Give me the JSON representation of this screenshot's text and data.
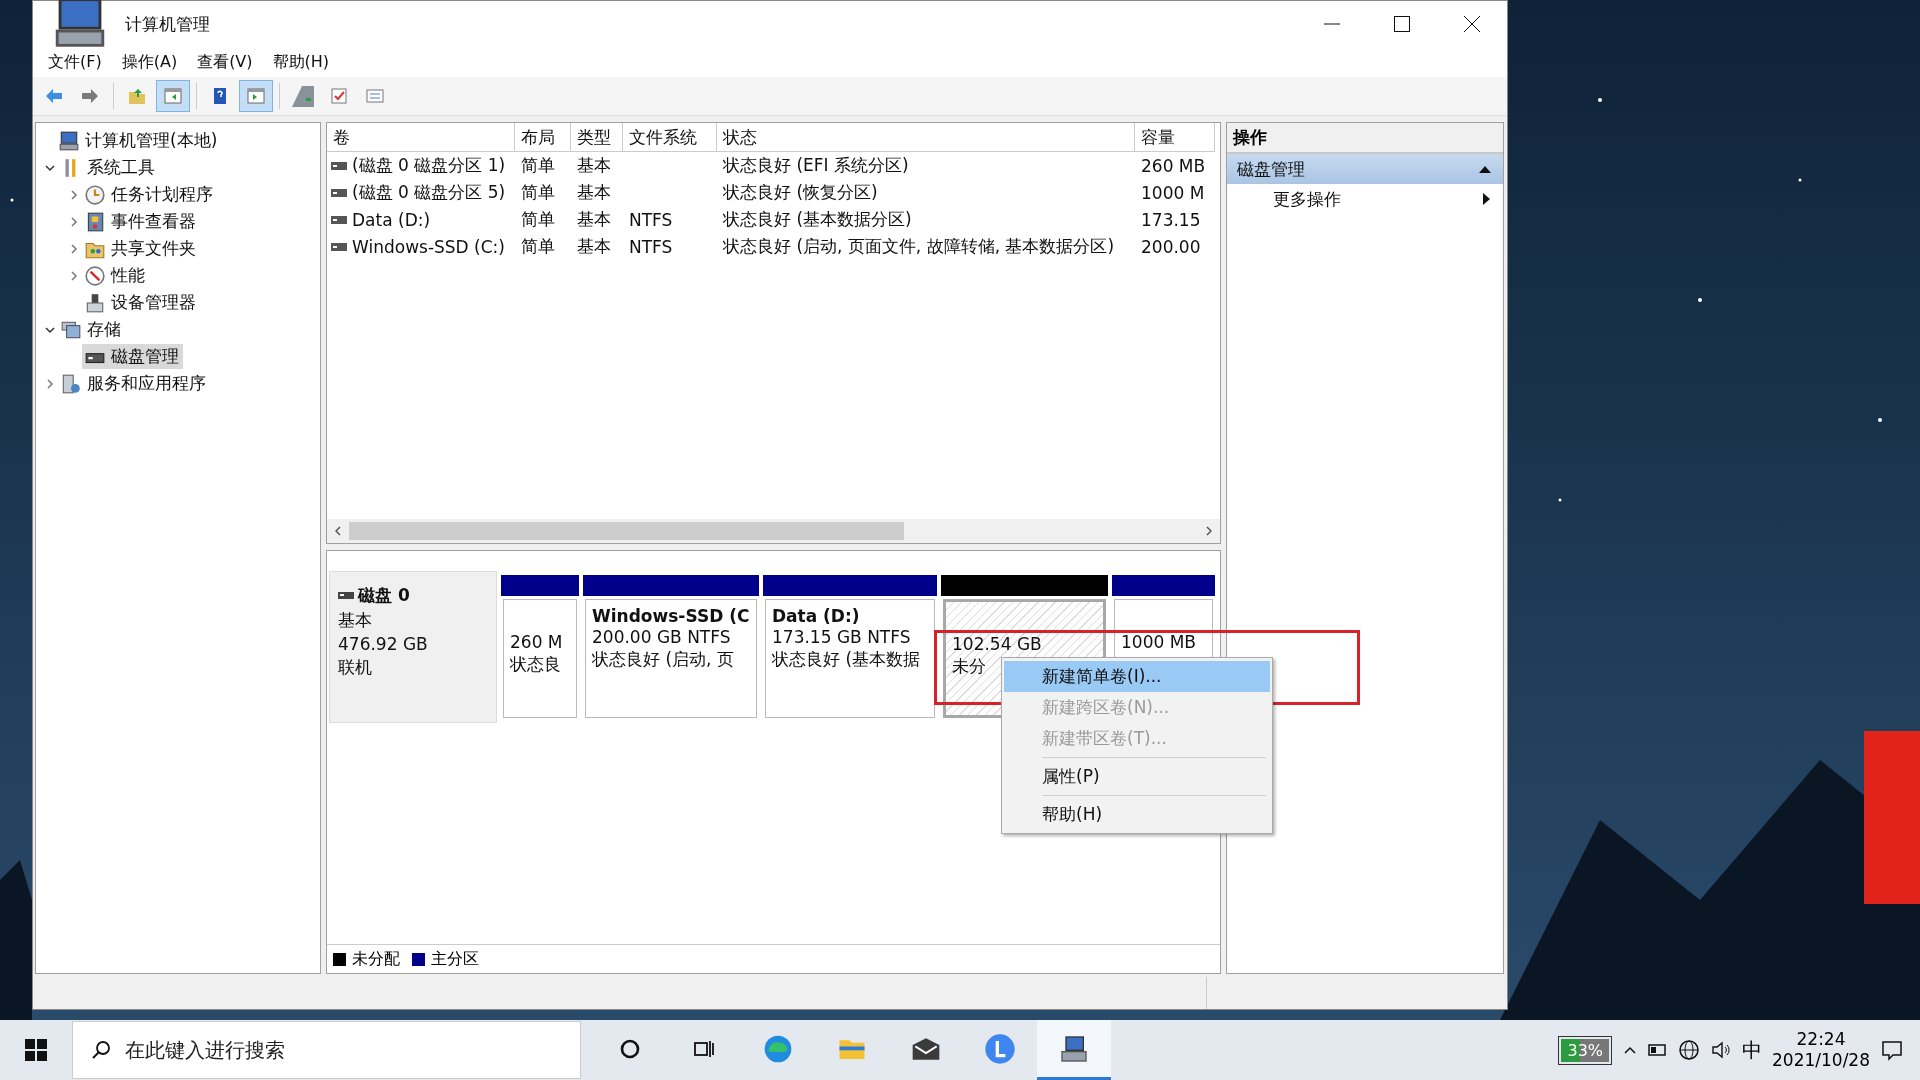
{
  "window": {
    "title": "计算机管理"
  },
  "menu": [
    "文件(F)",
    "操作(A)",
    "查看(V)",
    "帮助(H)"
  ],
  "toolbar": {
    "groups": [
      [
        {
          "kind": "back",
          "pressed": false
        },
        {
          "kind": "forward",
          "pressed": false
        }
      ],
      [
        {
          "kind": "up",
          "pressed": false
        },
        {
          "kind": "tree",
          "pressed": true
        }
      ],
      [
        {
          "kind": "help",
          "pressed": false
        },
        {
          "kind": "pane",
          "pressed": true
        }
      ],
      [
        {
          "kind": "connect",
          "pressed": false
        },
        {
          "kind": "check",
          "pressed": false
        },
        {
          "kind": "list",
          "pressed": false
        }
      ]
    ]
  },
  "tree": [
    {
      "label": "计算机管理(本地)",
      "kind": "computer",
      "selected": false,
      "children": [
        {
          "label": "系统工具",
          "kind": "tools",
          "expanded": true,
          "selected": false,
          "children": [
            {
              "label": "任务计划程序",
              "kind": "clock",
              "expanded": false,
              "selected": false
            },
            {
              "label": "事件查看器",
              "kind": "event",
              "expanded": false,
              "selected": false
            },
            {
              "label": "共享文件夹",
              "kind": "share",
              "expanded": false,
              "selected": false
            },
            {
              "label": "性能",
              "kind": "perf",
              "expanded": false,
              "selected": false
            },
            {
              "label": "设备管理器",
              "kind": "device",
              "selected": false
            }
          ]
        },
        {
          "label": "存储",
          "kind": "storage",
          "expanded": true,
          "selected": false,
          "children": [
            {
              "label": "磁盘管理",
              "kind": "disk",
              "selected": true
            }
          ]
        },
        {
          "label": "服务和应用程序",
          "kind": "services",
          "expanded": false,
          "selected": false
        }
      ]
    }
  ],
  "table": {
    "columns": [
      "卷",
      "布局",
      "类型",
      "文件系统",
      "状态",
      "容量"
    ],
    "rows": [
      {
        "cells": [
          "(磁盘 0 磁盘分区 1)",
          "简单",
          "基本",
          "",
          "状态良好 (EFI 系统分区)",
          "260 MB"
        ]
      },
      {
        "cells": [
          "(磁盘 0 磁盘分区 5)",
          "简单",
          "基本",
          "",
          "状态良好 (恢复分区)",
          "1000 M"
        ]
      },
      {
        "cells": [
          "Data (D:)",
          "简单",
          "基本",
          "NTFS",
          "状态良好 (基本数据分区)",
          "173.15"
        ]
      },
      {
        "cells": [
          "Windows-SSD (C:)",
          "简单",
          "基本",
          "NTFS",
          "状态良好 (启动, 页面文件, 故障转储, 基本数据分区)",
          "200.00"
        ]
      }
    ]
  },
  "disk": {
    "name": "磁盘 0",
    "type": "基本",
    "size": "476.92 GB",
    "status": "联机",
    "partitions": [
      {
        "kind": "primary",
        "selected": false,
        "lines": [
          "260 M",
          "状态良"
        ]
      },
      {
        "kind": "primary",
        "selected": false,
        "title": "Windows-SSD  (C",
        "lines": [
          "200.00 GB NTFS",
          "状态良好 (启动, 页"
        ]
      },
      {
        "kind": "primary",
        "selected": false,
        "title": "Data  (D:)",
        "lines": [
          "173.15 GB NTFS",
          "状态良好 (基本数据"
        ]
      },
      {
        "kind": "unallocated",
        "selected": true,
        "lines": [
          "102.54 GB",
          "未分"
        ]
      },
      {
        "kind": "primary",
        "selected": false,
        "lines": [
          "1000 MB"
        ]
      }
    ]
  },
  "legend": [
    {
      "label": "未分配",
      "color": "#000000"
    },
    {
      "label": "主分区",
      "color": "#00008b"
    }
  ],
  "context_menu": [
    {
      "kind": "item",
      "label": "新建简单卷(I)...",
      "selected": true,
      "disabled": false
    },
    {
      "kind": "item",
      "label": "新建跨区卷(N)...",
      "selected": false,
      "disabled": true
    },
    {
      "kind": "item",
      "label": "新建带区卷(T)...",
      "selected": false,
      "disabled": true
    },
    {
      "kind": "separator"
    },
    {
      "kind": "item",
      "label": "属性(P)",
      "selected": false,
      "disabled": false
    },
    {
      "kind": "separator"
    },
    {
      "kind": "item",
      "label": "帮助(H)",
      "selected": false,
      "disabled": false
    }
  ],
  "actions": {
    "title": "操作",
    "section": "磁盘管理",
    "expanded": true,
    "items": [
      "更多操作"
    ]
  },
  "taskbar": {
    "search": {
      "placeholder": "在此键入进行搜索"
    },
    "apps": [
      {
        "kind": "cortana",
        "selected": false
      },
      {
        "kind": "taskview",
        "selected": false
      },
      {
        "kind": "edge",
        "selected": false
      },
      {
        "kind": "folder",
        "selected": false
      },
      {
        "kind": "mail",
        "selected": false
      },
      {
        "kind": "lapp",
        "selected": false
      },
      {
        "kind": "compmgmt",
        "selected": true
      }
    ],
    "battery": "33%",
    "ime": "中",
    "time": "22:24",
    "date": "2021/10/28"
  }
}
